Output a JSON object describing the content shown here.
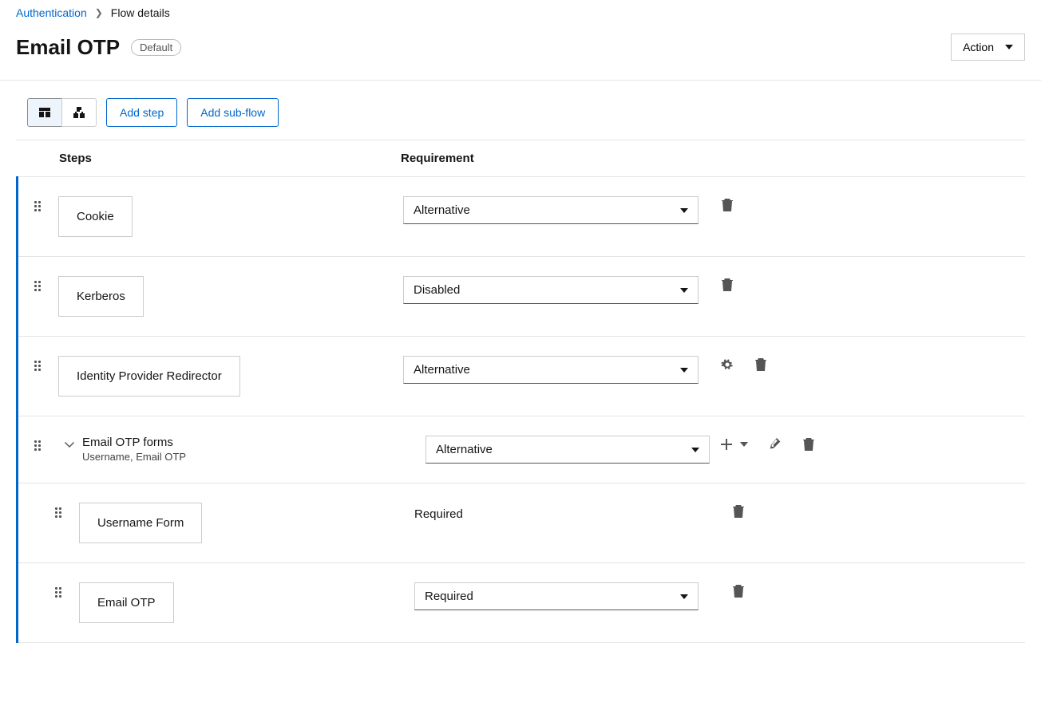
{
  "breadcrumb": {
    "parent": "Authentication",
    "current": "Flow details"
  },
  "title": "Email OTP",
  "badge": "Default",
  "action_button": "Action",
  "toolbar": {
    "add_step": "Add step",
    "add_subflow": "Add sub-flow"
  },
  "headers": {
    "steps": "Steps",
    "requirement": "Requirement"
  },
  "rows": [
    {
      "label": "Cookie",
      "requirement": "Alternative"
    },
    {
      "label": "Kerberos",
      "requirement": "Disabled"
    },
    {
      "label": "Identity Provider Redirector",
      "requirement": "Alternative"
    },
    {
      "label": "Email OTP forms",
      "sub": "Username, Email OTP",
      "requirement": "Alternative"
    },
    {
      "label": "Username Form",
      "requirement": "Required"
    },
    {
      "label": "Email OTP",
      "requirement": "Required"
    }
  ]
}
